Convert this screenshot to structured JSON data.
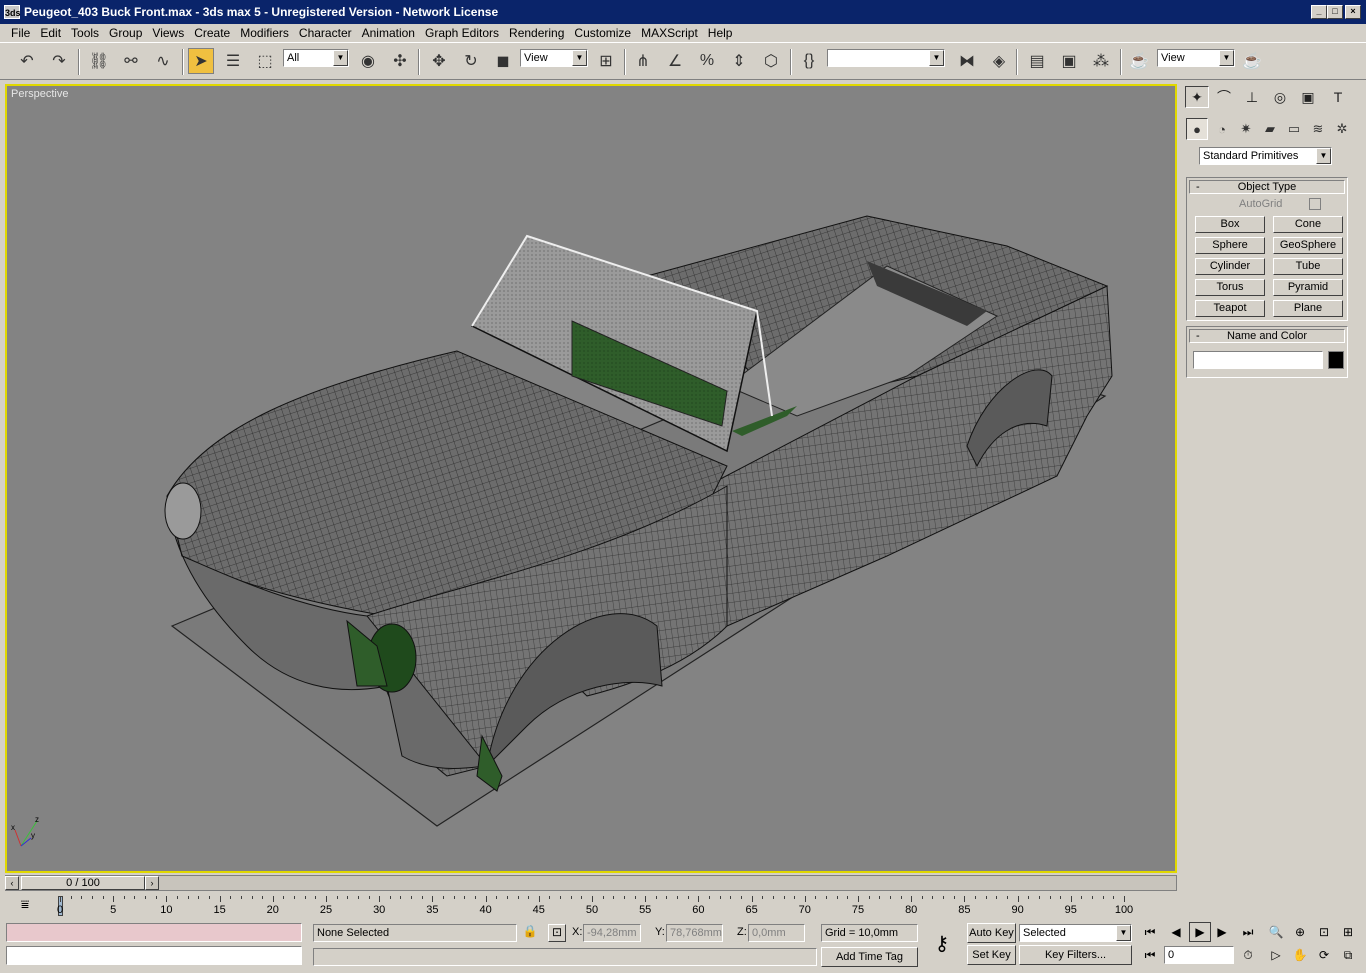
{
  "window": {
    "title": "Peugeot_403  Buck Front.max - 3ds max 5 - Unregistered Version - Network License",
    "app_icon_label": "3ds"
  },
  "menu": [
    "File",
    "Edit",
    "Tools",
    "Group",
    "Views",
    "Create",
    "Modifiers",
    "Character",
    "Animation",
    "Graph Editors",
    "Rendering",
    "Customize",
    "MAXScript",
    "Help"
  ],
  "toolbar": {
    "selection_filter": "All",
    "ref_coord": "View",
    "named_selection": "",
    "render_type": "View"
  },
  "viewport": {
    "label": "Perspective",
    "background": "#838383",
    "active_border": "#e0d800"
  },
  "command_panel": {
    "category": "Standard Primitives",
    "object_type_title": "Object Type",
    "autogrid_label": "AutoGrid",
    "buttons": [
      "Box",
      "Cone",
      "Sphere",
      "GeoSphere",
      "Cylinder",
      "Tube",
      "Torus",
      "Pyramid",
      "Teapot",
      "Plane"
    ],
    "name_color_title": "Name and Color",
    "name_value": "",
    "swatch_color": "#000000"
  },
  "timeline": {
    "slider_label": "0 / 100",
    "ticks": [
      "0",
      "5",
      "10",
      "15",
      "20",
      "25",
      "30",
      "35",
      "40",
      "45",
      "50",
      "55",
      "60",
      "65",
      "70",
      "75",
      "80",
      "85",
      "90",
      "95",
      "100"
    ]
  },
  "status": {
    "selection": "None Selected",
    "x_label": "X:",
    "x_value": "-94,28mm",
    "y_label": "Y:",
    "y_value": "78,768mm",
    "z_label": "Z:",
    "z_value": "0,0mm",
    "grid": "Grid = 10,0mm",
    "add_time_tag": "Add Time Tag",
    "auto_key": "Auto Key",
    "set_key": "Set Key",
    "key_mode": "Selected",
    "key_filters": "Key Filters...",
    "frame": "0"
  }
}
